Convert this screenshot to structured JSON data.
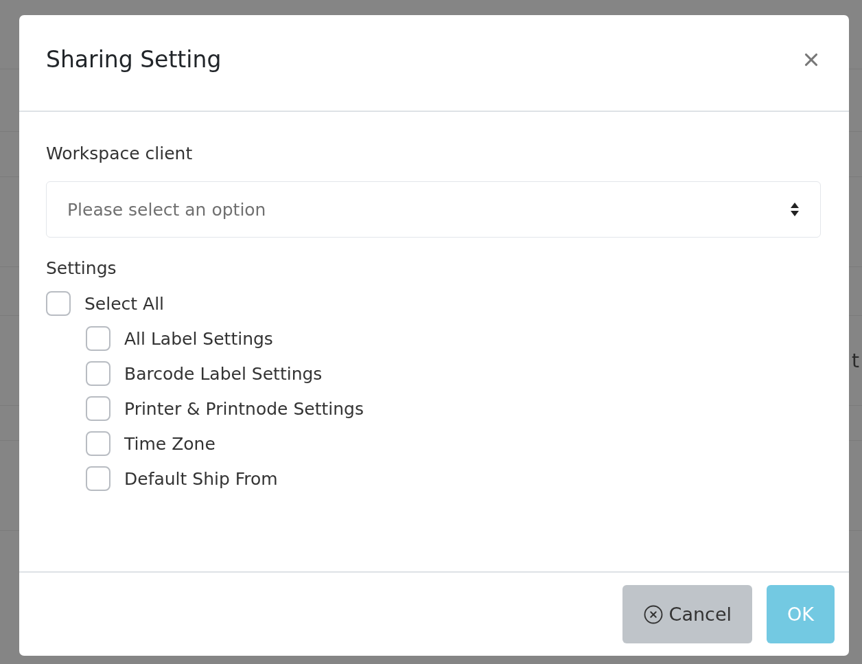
{
  "backdrop": {
    "text": "t"
  },
  "dialog": {
    "title": "Sharing Setting",
    "workspace": {
      "label": "Workspace client",
      "placeholder": "Please select an option"
    },
    "settings": {
      "label": "Settings",
      "items": [
        {
          "label": "Select All",
          "checked": false,
          "children": [
            {
              "label": "All Label Settings",
              "checked": false
            },
            {
              "label": "Barcode Label Settings",
              "checked": false
            },
            {
              "label": "Printer & Printnode Settings",
              "checked": false
            },
            {
              "label": "Time Zone",
              "checked": false
            },
            {
              "label": "Default Ship From",
              "checked": false
            }
          ]
        }
      ]
    },
    "buttons": [
      {
        "kind": "cancel",
        "label": "Cancel",
        "disabled": false
      },
      {
        "kind": "ok",
        "label": "OK",
        "disabled": true
      }
    ]
  }
}
